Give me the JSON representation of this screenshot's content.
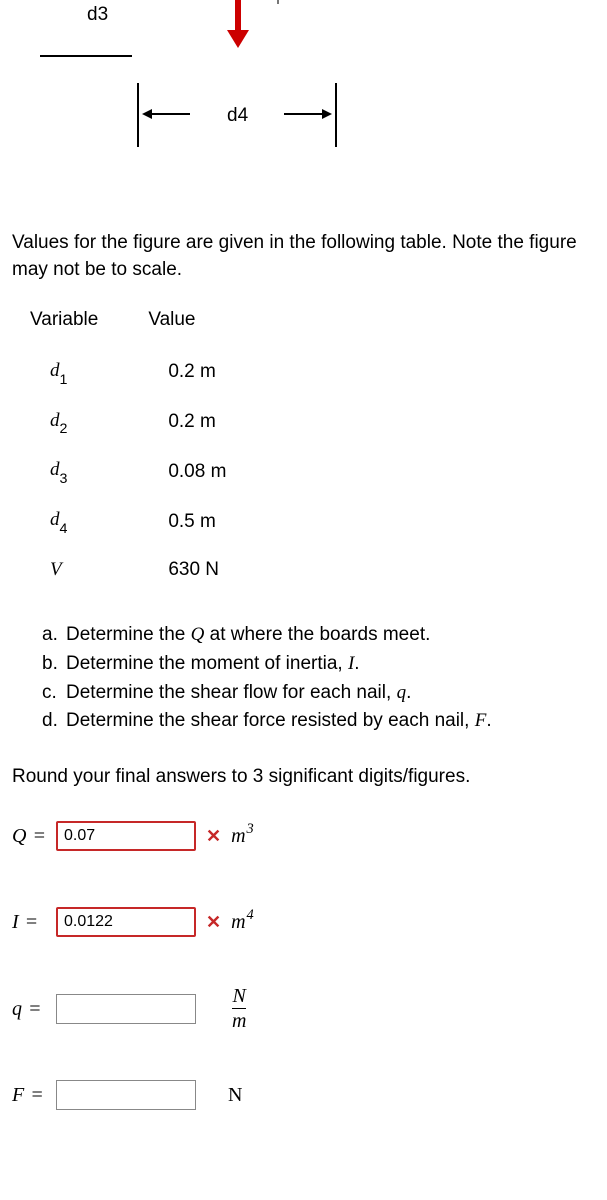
{
  "figure": {
    "d3_label": "d3",
    "d4_label": "d4"
  },
  "intro": "Values for the figure are given in the following table. Note the figure may not be to scale.",
  "table": {
    "head_variable": "Variable",
    "head_value": "Value",
    "rows": [
      {
        "var_base": "d",
        "var_sub": "1",
        "value": "0.2 m"
      },
      {
        "var_base": "d",
        "var_sub": "2",
        "value": "0.2 m"
      },
      {
        "var_base": "d",
        "var_sub": "3",
        "value": "0.08 m"
      },
      {
        "var_base": "d",
        "var_sub": "4",
        "value": "0.5 m"
      },
      {
        "var_base": "V",
        "var_sub": "",
        "value": "630 N"
      }
    ]
  },
  "parts": [
    {
      "letter": "a.",
      "text_before": "Determine the ",
      "sym": "Q",
      "text_after": " at where the boards meet."
    },
    {
      "letter": "b.",
      "text_before": "Determine the moment of inertia, ",
      "sym": "I",
      "text_after": "."
    },
    {
      "letter": "c.",
      "text_before": "Determine the shear flow for each nail, ",
      "sym": "q",
      "text_after": "."
    },
    {
      "letter": "d.",
      "text_before": "Determine the shear force resisted by each nail, ",
      "sym": "F",
      "text_after": "."
    }
  ],
  "round_note": "Round your final answers to 3 significant digits/figures.",
  "answers": {
    "Q": {
      "label": "Q",
      "value": "0.07",
      "wrong": true,
      "unit_base": "m",
      "unit_exp": "3"
    },
    "I": {
      "label": "I",
      "value": "0.0122",
      "wrong": true,
      "unit_base": "m",
      "unit_exp": "4"
    },
    "q": {
      "label": "q",
      "value": "",
      "unit_num": "N",
      "unit_den": "m"
    },
    "F": {
      "label": "F",
      "value": "",
      "unit": "N"
    }
  },
  "feedback_mark": "✕"
}
